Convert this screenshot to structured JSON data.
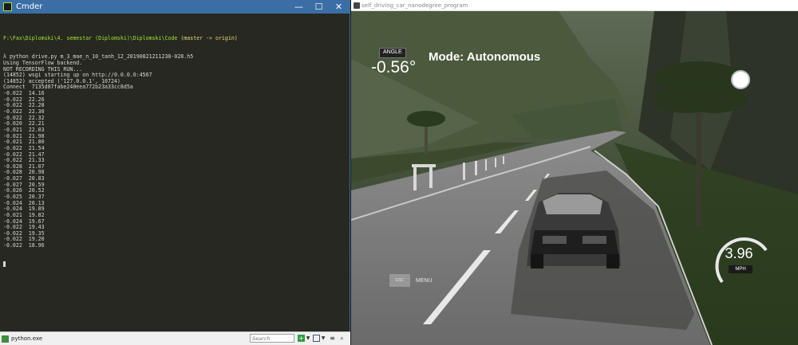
{
  "cmder": {
    "title": "Cmder",
    "minimize": "—",
    "maximize": "☐",
    "close": "✕",
    "terminal": {
      "prompt_path": "F:\\Fax\\Diplomski\\4. semestar (Diplomski)\\Diplomski\\Code",
      "prompt_git": " (master -> origin)",
      "lines": [
        "λ python drive.py m_3_mae_n_10_tanh_12_20190821211238-028.h5",
        "Using TensorFlow backend.",
        "NOT RECORDING THIS RUN...",
        "(14852) wsgi starting up on http://0.0.0.0:4567",
        "(14852) accepted ('127.0.0.1', 10724)",
        "Connect  7135d87fabe240eea772b23a33cc8d5a",
        "-0.022  14.16",
        "-0.022  22.26",
        "-0.022  22.28",
        "-0.022  22.30",
        "-0.022  22.32",
        "-0.020  22.21",
        "-0.021  22.03",
        "-0.021  21.98",
        "-0.021  21.80",
        "-0.022  21.54",
        "-0.022  21.47",
        "-0.022  21.33",
        "-0.028  21.07",
        "-0.028  20.98",
        "-0.027  20.83",
        "-0.027  20.59",
        "-0.026  20.52",
        "-0.025  20.37",
        "-0.024  20.13",
        "-0.024  19.89",
        "-0.021  19.82",
        "-0.024  19.67",
        "-0.022  19.43",
        "-0.022  19.35",
        "-0.022  19.20",
        "-0.022  18.96"
      ]
    },
    "statusbar": {
      "tab_label": "python.exe",
      "search_placeholder": "Search"
    }
  },
  "simulator": {
    "title": "self_driving_car_nanodegree_program",
    "hud": {
      "angle_label": "ANGLE",
      "angle_value": "-0.56°",
      "mode": "Mode: Autonomous",
      "esc_label": "ESC",
      "menu_label": "MENU",
      "speed_value": "3.96",
      "speed_unit": "MPH"
    }
  },
  "colors": {
    "cmder_titlebar": "#3a6ea5",
    "terminal_bg": "#272822",
    "prompt_path": "#a6e22e",
    "prompt_git": "#e6db74",
    "terminal_text": "#d8d8d0"
  },
  "icons": {
    "cmder_app": "cmder-icon",
    "sim_app": "unity-icon",
    "tab": "python-tab-icon",
    "add": "plus-icon",
    "split": "split-view-icon",
    "menu": "hamburger-icon",
    "search": "search-icon"
  }
}
